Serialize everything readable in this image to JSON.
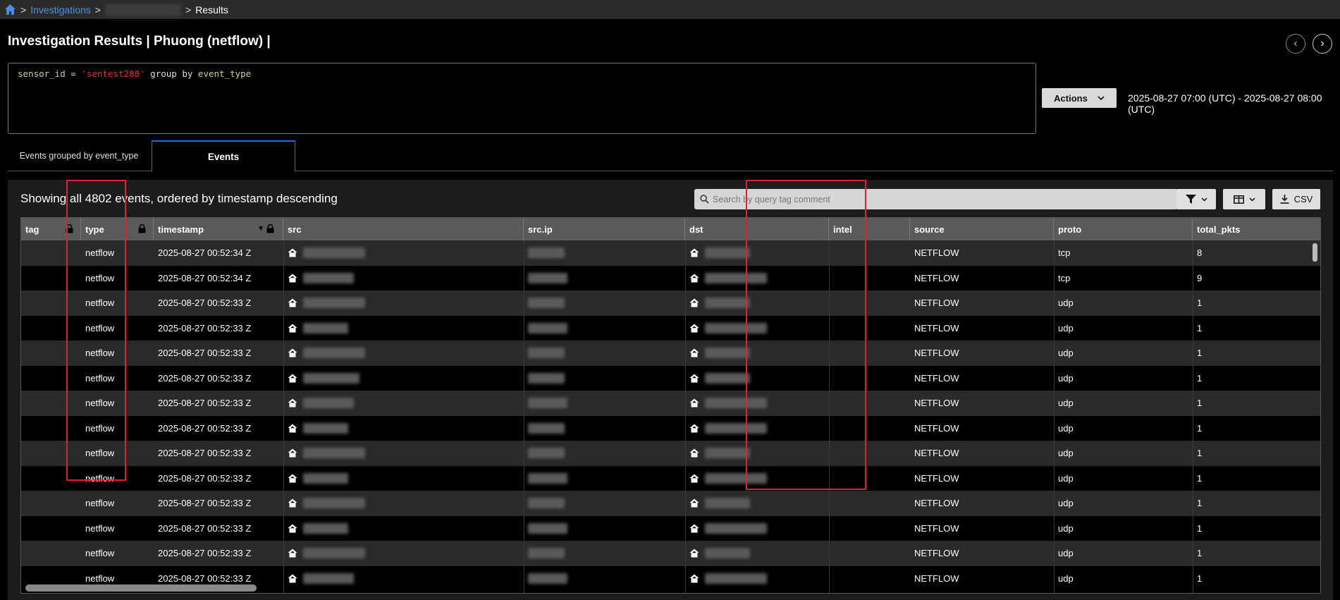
{
  "breadcrumb": {
    "items": [
      "Investigations",
      "Results"
    ],
    "separator": ">"
  },
  "page": {
    "title": "Investigation Results | Phuong (netflow) |"
  },
  "query": {
    "key": "sensor_id",
    "op": "=",
    "value": "'sentest288'",
    "group_kw": "group by",
    "group_field": "event_type"
  },
  "actions": {
    "label": "Actions"
  },
  "time_range": "2025-08-27 07:00 (UTC) - 2025-08-27 08:00 (UTC)",
  "tabs": [
    {
      "label": "Events grouped by event_type",
      "active": false
    },
    {
      "label": "Events",
      "active": true
    }
  ],
  "events": {
    "summary": "Showing all 4802 events, ordered by timestamp descending",
    "search_placeholder": "Search by query tag comment",
    "csv_label": "CSV",
    "columns": [
      "tag",
      "type",
      "timestamp",
      "src",
      "src.ip",
      "dst",
      "intel",
      "source",
      "proto",
      "total_pkts"
    ],
    "rows": [
      {
        "type": "netflow",
        "timestamp": "2025-08-27 00:52:34 Z",
        "source": "NETFLOW",
        "proto": "tcp",
        "total_pkts": "8"
      },
      {
        "type": "netflow",
        "timestamp": "2025-08-27 00:52:34 Z",
        "source": "NETFLOW",
        "proto": "tcp",
        "total_pkts": "9"
      },
      {
        "type": "netflow",
        "timestamp": "2025-08-27 00:52:33 Z",
        "source": "NETFLOW",
        "proto": "udp",
        "total_pkts": "1"
      },
      {
        "type": "netflow",
        "timestamp": "2025-08-27 00:52:33 Z",
        "source": "NETFLOW",
        "proto": "udp",
        "total_pkts": "1"
      },
      {
        "type": "netflow",
        "timestamp": "2025-08-27 00:52:33 Z",
        "source": "NETFLOW",
        "proto": "udp",
        "total_pkts": "1"
      },
      {
        "type": "netflow",
        "timestamp": "2025-08-27 00:52:33 Z",
        "source": "NETFLOW",
        "proto": "udp",
        "total_pkts": "1"
      },
      {
        "type": "netflow",
        "timestamp": "2025-08-27 00:52:33 Z",
        "source": "NETFLOW",
        "proto": "udp",
        "total_pkts": "1"
      },
      {
        "type": "netflow",
        "timestamp": "2025-08-27 00:52:33 Z",
        "source": "NETFLOW",
        "proto": "udp",
        "total_pkts": "1"
      },
      {
        "type": "netflow",
        "timestamp": "2025-08-27 00:52:33 Z",
        "source": "NETFLOW",
        "proto": "udp",
        "total_pkts": "1"
      },
      {
        "type": "netflow",
        "timestamp": "2025-08-27 00:52:33 Z",
        "source": "NETFLOW",
        "proto": "udp",
        "total_pkts": "1"
      },
      {
        "type": "netflow",
        "timestamp": "2025-08-27 00:52:33 Z",
        "source": "NETFLOW",
        "proto": "udp",
        "total_pkts": "1"
      },
      {
        "type": "netflow",
        "timestamp": "2025-08-27 00:52:33 Z",
        "source": "NETFLOW",
        "proto": "udp",
        "total_pkts": "1"
      },
      {
        "type": "netflow",
        "timestamp": "2025-08-27 00:52:33 Z",
        "source": "NETFLOW",
        "proto": "udp",
        "total_pkts": "1"
      },
      {
        "type": "netflow",
        "timestamp": "2025-08-27 00:52:33 Z",
        "source": "NETFLOW",
        "proto": "udp",
        "total_pkts": "1"
      }
    ]
  },
  "colors": {
    "link": "#4d8fe8",
    "highlight": "#d9262c",
    "tab_accent": "#1e6fd9"
  }
}
